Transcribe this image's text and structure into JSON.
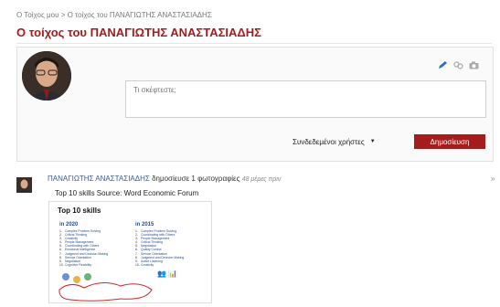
{
  "breadcrumb": "Ο Τοίχος μου > Ο τοίχος του ΠΑΝΑΓΙΩΤΗΣ ΑΝΑΣΤΑΣΙΑΔΗΣ",
  "page_title": "Ο τοίχος του ΠΑΝΑΓΙΩΤΗΣ ΑΝΑΣΤΑΣΙΑΔΗΣ",
  "composer": {
    "placeholder": "Τι σκέφτεστε;",
    "visibility": "Συνδεδεμένοι χρήστες",
    "publish_label": "Δημοσίευση",
    "icons": [
      "pencil-icon",
      "link-icon",
      "camera-icon"
    ]
  },
  "post": {
    "author": "ΠΑΝΑΓΙΩΤΗΣ ΑΝΑΣΤΑΣΙΑΔΗΣ",
    "action": "δημοσίευσε 1 φωτογραφίες",
    "time": "48 μέρες πριν",
    "caption": "Top 10 skills Source: Word Economic Forum",
    "menu_icon": "chevron-right-icon",
    "image": {
      "title": "Top 10 skills",
      "col_left_head": "in 2020",
      "col_right_head": "in 2015",
      "list_2020": [
        "Complex Problem Solving",
        "Critical Thinking",
        "Creativity",
        "People Management",
        "Coordinating with Others",
        "Emotional Intelligence",
        "Judgment and Decision Making",
        "Service Orientation",
        "Negotiation",
        "Cognitive Flexibility"
      ],
      "list_2015": [
        "Complex Problem Solving",
        "Coordinating with Others",
        "People Management",
        "Critical Thinking",
        "Negotiation",
        "Quality Control",
        "Service Orientation",
        "Judgment and Decision Making",
        "Active Listening",
        "Creativity"
      ]
    }
  },
  "colors": {
    "accent": "#a51c1c",
    "link": "#3b5998"
  }
}
